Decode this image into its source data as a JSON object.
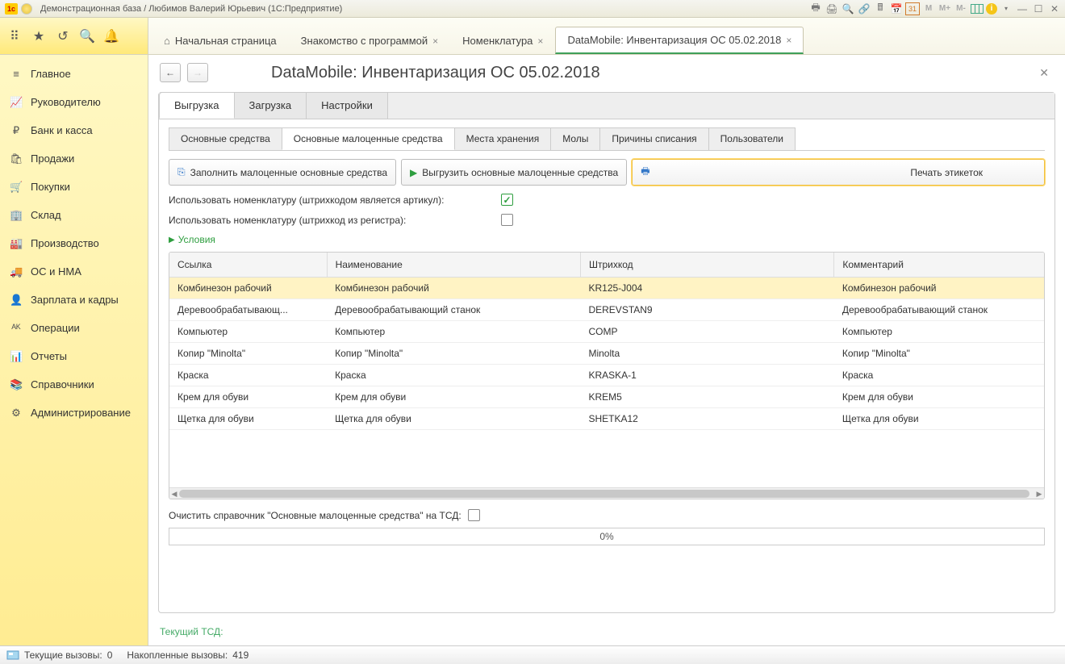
{
  "titlebar": {
    "title": "Демонстрационная база / Любимов Валерий Юрьевич  (1С:Предприятие)"
  },
  "tabs": [
    {
      "label": "Начальная страница",
      "home": true,
      "closable": false,
      "active": false
    },
    {
      "label": "Знакомство с программой",
      "home": false,
      "closable": true,
      "active": false
    },
    {
      "label": "Номенклатура",
      "home": false,
      "closable": true,
      "active": false
    },
    {
      "label": "DataMobile: Инвентаризация ОС 05.02.2018",
      "home": false,
      "closable": true,
      "active": true
    }
  ],
  "sidebar": {
    "items": [
      {
        "icon": "≡",
        "label": "Главное"
      },
      {
        "icon": "📈",
        "label": "Руководителю"
      },
      {
        "icon": "₽",
        "label": "Банк и касса"
      },
      {
        "icon": "🛍",
        "label": "Продажи"
      },
      {
        "icon": "🛒",
        "label": "Покупки"
      },
      {
        "icon": "🏢",
        "label": "Склад"
      },
      {
        "icon": "🏭",
        "label": "Производство"
      },
      {
        "icon": "🚚",
        "label": "ОС и НМА"
      },
      {
        "icon": "👤",
        "label": "Зарплата и кадры"
      },
      {
        "icon": "ᴬᴷ",
        "label": "Операции"
      },
      {
        "icon": "📊",
        "label": "Отчеты"
      },
      {
        "icon": "📚",
        "label": "Справочники"
      },
      {
        "icon": "⚙",
        "label": "Администрирование"
      }
    ]
  },
  "page": {
    "title": "DataMobile: Инвентаризация ОС 05.02.2018",
    "upper_tabs": [
      "Выгрузка",
      "Загрузка",
      "Настройки"
    ],
    "upper_active": 0,
    "sub_tabs": [
      "Основные средства",
      "Основные малоценные средства",
      "Места хранения",
      "Молы",
      "Причины списания",
      "Пользователи"
    ],
    "sub_active": 1,
    "buttons": {
      "fill": "Заполнить малоценные основные средства",
      "upload": "Выгрузить основные малоценные средства",
      "print": "Печать этикеток"
    },
    "options": {
      "use_nomenclature_article": "Использовать номенклатуру (штрихкодом является артикул):",
      "use_nomenclature_register": "Использовать номенклатуру (штрихкод из регистра):",
      "checked1": true,
      "checked2": false
    },
    "conditions": "Условия",
    "columns": [
      "Ссылка",
      "Наименование",
      "Штрихкод",
      "Комментарий"
    ],
    "rows": [
      {
        "link": "Комбинезон рабочий",
        "name": "Комбинезон рабочий",
        "barcode": "KR125-J004",
        "comment": "Комбинезон рабочий",
        "selected": true
      },
      {
        "link": "Деревообрабатывающ...",
        "name": "Деревообрабатывающий станок",
        "barcode": "DEREVSTAN9",
        "comment": "Деревообрабатывающий станок"
      },
      {
        "link": "Компьютер",
        "name": "Компьютер",
        "barcode": "COMP",
        "comment": "Компьютер"
      },
      {
        "link": "Копир \"Minolta\"",
        "name": "Копир \"Minolta\"",
        "barcode": "Minolta",
        "comment": "Копир \"Minolta\""
      },
      {
        "link": "Краска",
        "name": "Краска",
        "barcode": "KRASKA-1",
        "comment": "Краска"
      },
      {
        "link": "Крем для обуви",
        "name": "Крем для обуви",
        "barcode": "KREM5",
        "comment": "Крем для обуви"
      },
      {
        "link": "Щетка для обуви",
        "name": "Щетка для обуви",
        "barcode": "SHETKA12",
        "comment": "Щетка для обуви"
      }
    ],
    "clear_label": "Очистить справочник \"Основные малоценные средства\" на ТСД:",
    "progress": "0%",
    "tsd": "Текущий ТСД:"
  },
  "statusbar": {
    "calls_current_label": "Текущие вызовы:",
    "calls_current": "0",
    "calls_acc_label": "Накопленные вызовы:",
    "calls_acc": "419"
  }
}
